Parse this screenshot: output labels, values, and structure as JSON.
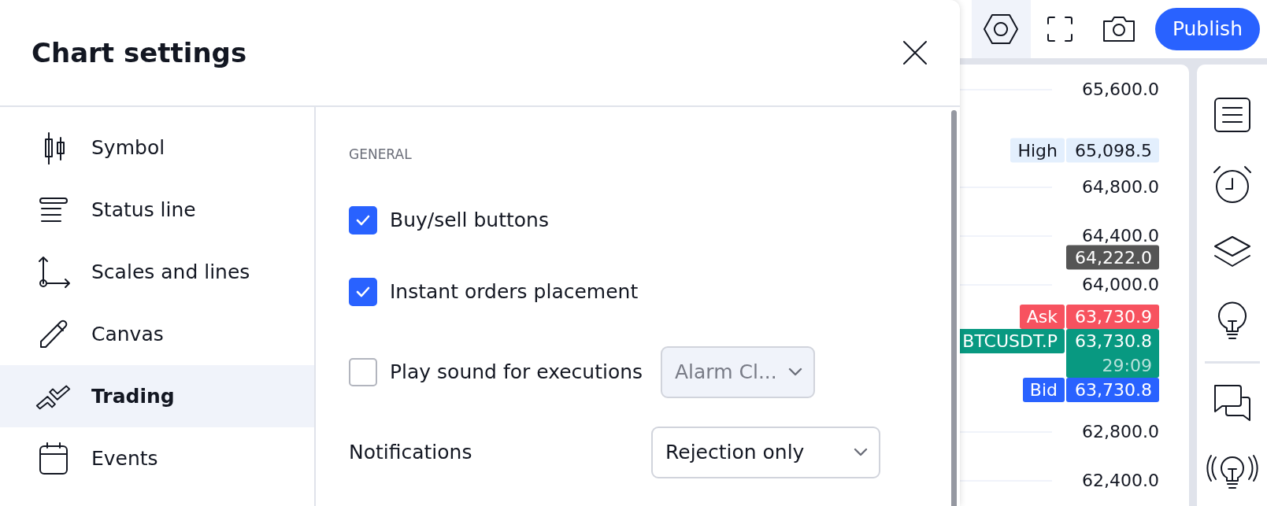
{
  "top_tools": [
    {
      "selected": true
    },
    {
      "selected": false
    },
    {
      "selected": false
    }
  ],
  "publish": "Publish",
  "price_scale": {
    "ticks": [
      "65,600.0",
      "64,800.0",
      "64,400.0",
      "64,000.0",
      "62,800.0",
      "62,400.0"
    ],
    "labels": [
      {
        "kind": "single",
        "tag": "High",
        "price": "65,098.5",
        "color": "#e3effd"
      },
      {
        "kind": "single",
        "price": "64,222.0",
        "color": "#555555"
      },
      {
        "kind": "stack",
        "tag": "Ask",
        "price": "63,730.9",
        "color": "#f7525f"
      },
      {
        "kind": "stack",
        "tag": "BTCUSDT.P",
        "price": "63,730.8",
        "countdown": "29:09",
        "color": "#089981"
      },
      {
        "kind": "stack",
        "tag": "Bid",
        "price": "63,730.8",
        "color": "#2962ff"
      }
    ]
  },
  "dialog": {
    "title": "Chart settings",
    "sidebar": {
      "items": [
        {
          "label": "Symbol",
          "selected": false
        },
        {
          "label": "Status line",
          "selected": false
        },
        {
          "label": "Scales and lines",
          "selected": false
        },
        {
          "label": "Canvas",
          "selected": false
        },
        {
          "label": "Trading",
          "selected": true
        },
        {
          "label": "Events",
          "selected": false
        }
      ]
    },
    "section": "GENERAL",
    "options": [
      {
        "kind": "checkbox",
        "label": "Buy/sell buttons",
        "checked": true
      },
      {
        "kind": "checkbox",
        "label": "Instant orders placement",
        "checked": true
      },
      {
        "kind": "checkbox",
        "label": "Play sound for executions",
        "checked": false,
        "select": {
          "value": "Alarm Cl...",
          "disabled": true
        }
      },
      {
        "kind": "select",
        "label": "Notifications",
        "select": {
          "value": "Rejection only",
          "disabled": false
        }
      }
    ]
  }
}
